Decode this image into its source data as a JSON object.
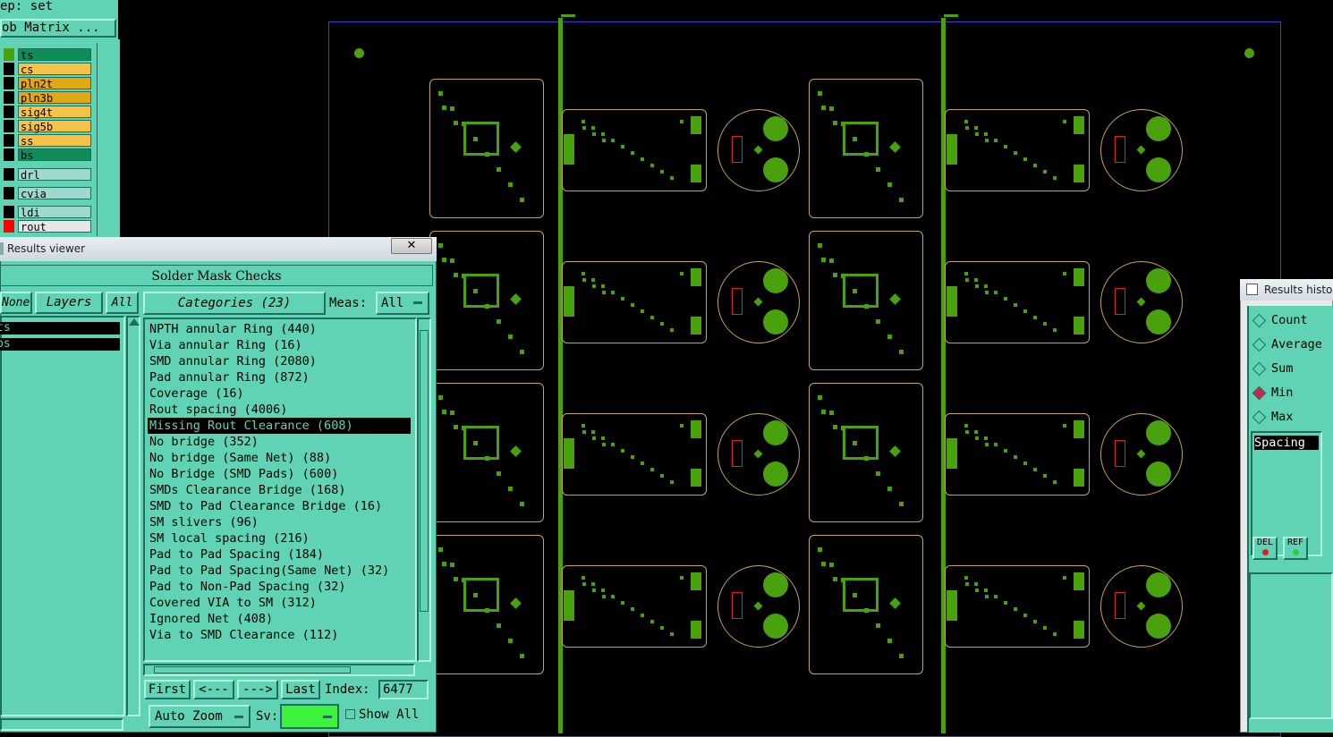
{
  "top_left": {
    "step_label": "ep: set",
    "job_matrix_button": "ob Matrix ..."
  },
  "layers": [
    {
      "name": "ts",
      "swatch": "#4aa10e",
      "bg": "#108c5b",
      "text": "#000000"
    },
    {
      "name": "cs",
      "swatch": "#000000",
      "bg": "#f7c24a",
      "text": "#000000"
    },
    {
      "name": "pln2t",
      "swatch": "#000000",
      "bg": "#e2a716",
      "text": "#000000"
    },
    {
      "name": "pln3b",
      "swatch": "#000000",
      "bg": "#e2a716",
      "text": "#000000"
    },
    {
      "name": "sig4t",
      "swatch": "#000000",
      "bg": "#f7c24a",
      "text": "#000000"
    },
    {
      "name": "sig5b",
      "swatch": "#000000",
      "bg": "#f7c24a",
      "text": "#000000"
    },
    {
      "name": "ss",
      "swatch": "#000000",
      "bg": "#f7c24a",
      "text": "#000000"
    },
    {
      "name": "bs",
      "swatch": "#000000",
      "bg": "#108c5b",
      "text": "#000000"
    },
    {
      "name": "drl",
      "swatch": "#000000",
      "bg": "#9fd8cf",
      "text": "#000000"
    },
    {
      "name": "cvia",
      "swatch": "#000000",
      "bg": "#9fd8cf",
      "text": "#000000"
    },
    {
      "name": "ldi",
      "swatch": "#000000",
      "bg": "#9fd8cf",
      "text": "#000000"
    },
    {
      "name": "rout",
      "swatch": "#ff0000",
      "bg": "#e6e6e6",
      "text": "#000000"
    }
  ],
  "results_viewer": {
    "title": "Results viewer",
    "close_glyph": "✕",
    "heading": "Solder Mask Checks",
    "none_button": "None",
    "layers_button": "Layers",
    "all_button": "All",
    "layer_items": [
      "ts",
      "bs"
    ],
    "categories_button": "Categories (23)",
    "meas_label": "Meas:",
    "meas_value": "All",
    "categories": [
      "NPTH annular Ring (440)",
      "Via annular Ring (16)",
      "SMD annular Ring (2080)",
      "Pad annular Ring (872)",
      "Coverage (16)",
      "Rout spacing (4006)",
      "Missing Rout Clearance (608)",
      "No bridge (352)",
      "No bridge (Same Net) (88)",
      "No Bridge (SMD Pads) (600)",
      "SMDs Clearance Bridge (168)",
      "SMD to Pad Clearance Bridge (16)",
      "SM slivers (96)",
      "SM local spacing (216)",
      "Pad to Pad Spacing (184)",
      "Pad to Pad Spacing(Same Net) (32)",
      "Pad to Non-Pad Spacing (32)",
      "Covered VIA to SM (312)",
      "Ignored Net (408)",
      "Via to SMD Clearance (112)"
    ],
    "selected_category": "Missing Rout Clearance (608)",
    "nav": {
      "first": "First",
      "prev": "<---",
      "next": "--->",
      "last": "Last",
      "index_label": "Index:",
      "index_value": "6477"
    },
    "auto_zoom": "Auto Zoom",
    "sv_label": "Sv:",
    "show_all": "Show All"
  },
  "histogram": {
    "title": "Results histog",
    "options": [
      "Count",
      "Average",
      "Sum",
      "Min",
      "Max"
    ],
    "selected": "Min",
    "measure_item": "Spacing",
    "del_button": "DEL",
    "ref_button": "REF"
  },
  "colors": {
    "panel": "#5fd3b3",
    "copper_green": "#4aa10e",
    "outline": "#c7a45a",
    "profile": "#3b3bd6",
    "selection": "#000000"
  }
}
